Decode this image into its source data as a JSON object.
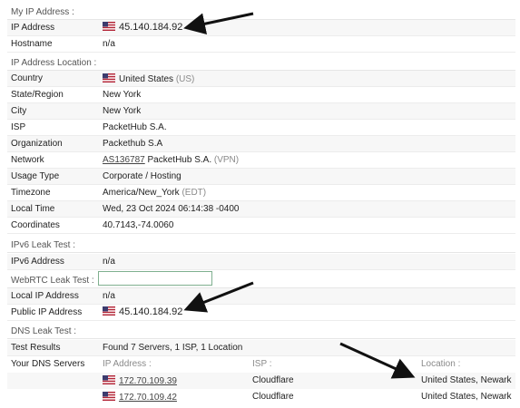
{
  "my_ip": {
    "section_title": "My IP Address :",
    "rows": [
      {
        "label": "IP Address",
        "value": "45.140.184.92",
        "flag": "us-flag-icon"
      },
      {
        "label": "Hostname",
        "value": "n/a"
      }
    ]
  },
  "location": {
    "section_title": "IP Address Location :",
    "country": {
      "label": "Country",
      "value": "United States",
      "suffix": "(US)"
    },
    "region": {
      "label": "State/Region",
      "value": "New York"
    },
    "city": {
      "label": "City",
      "value": "New York"
    },
    "isp": {
      "label": "ISP",
      "value": "PacketHub S.A."
    },
    "organization": {
      "label": "Organization",
      "value": "Packethub S.A"
    },
    "network": {
      "label": "Network",
      "link": "AS136787",
      "value": "PacketHub S.A.",
      "suffix": "(VPN)"
    },
    "usage": {
      "label": "Usage Type",
      "value": "Corporate / Hosting"
    },
    "timezone": {
      "label": "Timezone",
      "value": "America/New_York",
      "suffix": "(EDT)"
    },
    "local_time": {
      "label": "Local Time",
      "value": "Wed, 23 Oct 2024 06:14:38 -0400"
    },
    "coordinates": {
      "label": "Coordinates",
      "value": "40.7143,-74.0060"
    }
  },
  "ipv6": {
    "section_title": "IPv6 Leak Test :",
    "row": {
      "label": "IPv6 Address",
      "value": "n/a"
    }
  },
  "webrtc": {
    "section_title": "WebRTC Leak Test :",
    "local": {
      "label": "Local IP Address",
      "value": "n/a"
    },
    "public": {
      "label": "Public IP Address",
      "value": "45.140.184.92"
    }
  },
  "dns": {
    "section_title": "DNS Leak Test :",
    "results": {
      "label": "Test Results",
      "value": "Found 7 Servers, 1 ISP, 1 Location"
    },
    "servers_label": "Your DNS Servers",
    "headers": {
      "ip": "IP Address :",
      "isp": "ISP :",
      "location": "Location :"
    },
    "servers": [
      {
        "ip": "172.70.109.39",
        "isp": "Cloudflare",
        "location": "United States, Newark"
      },
      {
        "ip": "172.70.109.42",
        "isp": "Cloudflare",
        "location": "United States, Newark"
      }
    ]
  },
  "colors": {
    "link": "#444444",
    "input_border": "#7fb08f",
    "arrow": "#111111"
  }
}
